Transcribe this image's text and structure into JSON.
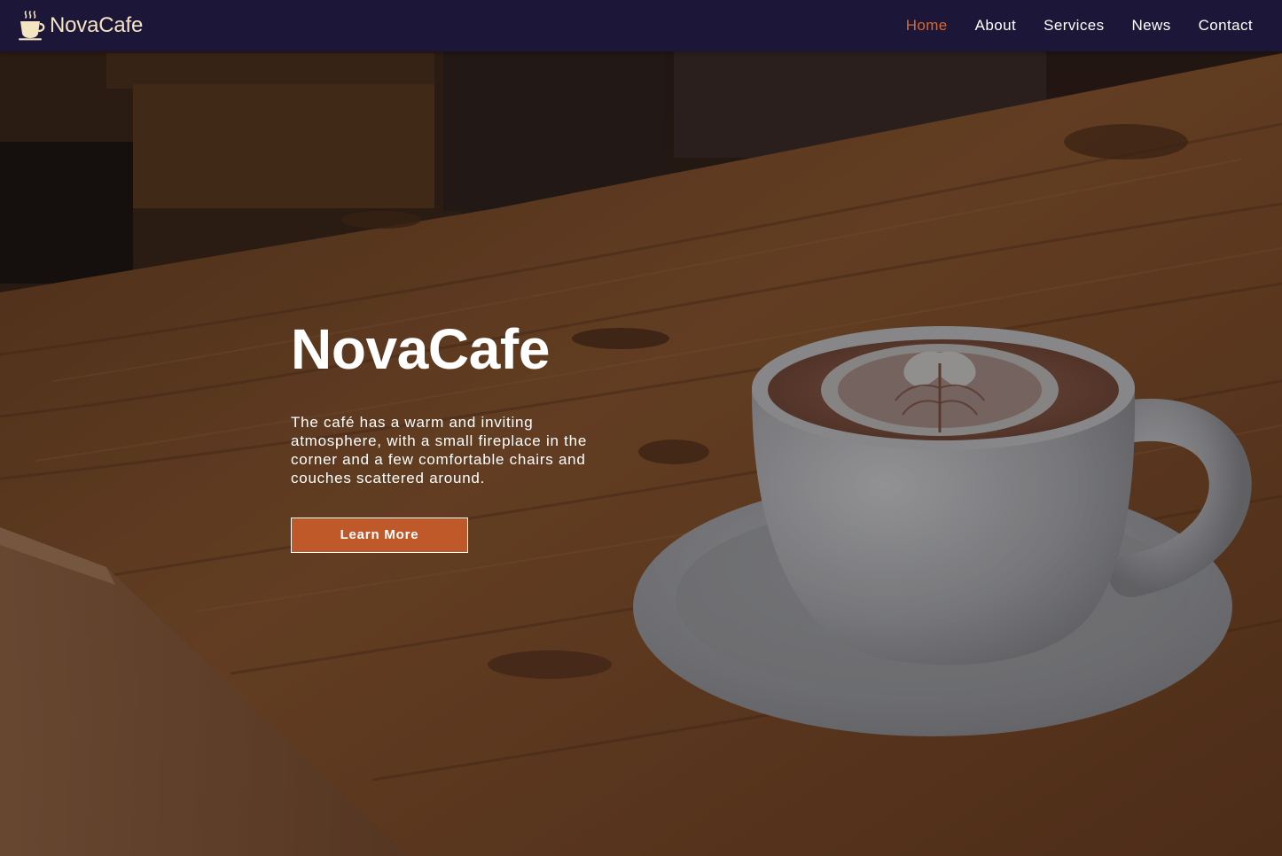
{
  "header": {
    "brand_name": "NovaCafe",
    "brand_icon": "coffee-cup-icon",
    "nav": [
      {
        "label": "Home",
        "active": true
      },
      {
        "label": "About",
        "active": false
      },
      {
        "label": "Services",
        "active": false
      },
      {
        "label": "News",
        "active": false
      },
      {
        "label": "Contact",
        "active": false
      }
    ]
  },
  "hero": {
    "title": "NovaCafe",
    "description": "The café has a warm and inviting atmosphere, with a small fireplace in the corner and a few comfortable chairs and couches scattered around.",
    "button_label": "Learn More",
    "background_image": "latte-cup-on-wooden-table"
  },
  "colors": {
    "header_bg": "#1c1638",
    "brand_text": "#f3e4c2",
    "nav_active": "#d26a35",
    "nav_text": "#ffffff",
    "button_bg": "#c0592a",
    "button_border": "#ffffff"
  }
}
